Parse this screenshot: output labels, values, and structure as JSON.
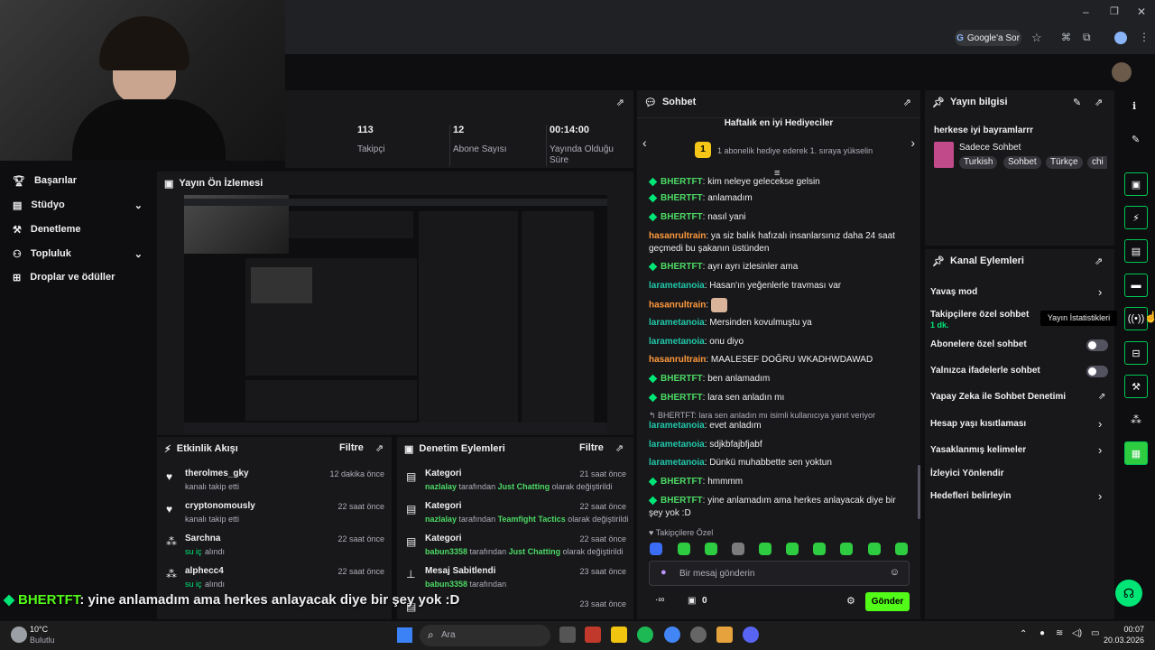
{
  "browser": {
    "google_sor": "Google'a Sor"
  },
  "stats": [
    {
      "value": "113",
      "label": "Takipçi"
    },
    {
      "value": "12",
      "label": "Abone Sayısı"
    },
    {
      "value": "00:14:00",
      "label": "Yayında Olduğu Süre"
    }
  ],
  "sidebar": {
    "items": [
      {
        "label": "Başarılar"
      },
      {
        "label": "Stüdyo"
      },
      {
        "label": "Denetleme"
      },
      {
        "label": "Topluluk"
      },
      {
        "label": "Droplar ve ödüller"
      }
    ]
  },
  "preview": {
    "title": "Yayın Ön İzlemesi"
  },
  "activity": {
    "title": "Etkinlik Akışı",
    "filter": "Filtre",
    "items": [
      {
        "name": "therolmes_gky",
        "sub": "kanalı takip etti",
        "time": "12 dakika önce"
      },
      {
        "name": "cryptonomously",
        "sub": "kanalı takip etti",
        "time": "22 saat önce"
      },
      {
        "name": "Sarchna",
        "sub_accent": "su iç",
        "sub": "alındı",
        "time": "22 saat önce"
      },
      {
        "name": "alphecc4",
        "sub_accent": "su iç",
        "sub": "alındı",
        "time": "22 saat önce"
      }
    ]
  },
  "modlog": {
    "title": "Denetim Eylemleri",
    "filter": "Filtre",
    "items": [
      {
        "title": "Kategori",
        "user": "nazlalay",
        "mid": "tarafından",
        "accent": "Just Chatting",
        "tail": "olarak değiştirildi",
        "time": "21 saat önce"
      },
      {
        "title": "Kategori",
        "user": "nazlalay",
        "mid": "tarafından",
        "accent": "Teamfight Tactics",
        "tail": "olarak değiştirildi",
        "time": "22 saat önce"
      },
      {
        "title": "Kategori",
        "user": "babun3358",
        "mid": "tarafından",
        "accent": "Just Chatting",
        "tail": "olarak değiştirildi",
        "time": "22 saat önce"
      },
      {
        "title": "Mesaj Sabitlendi",
        "user": "babun3358",
        "mid": "tarafından",
        "accent": "",
        "tail": "",
        "time": "23 saat önce"
      },
      {
        "title": "",
        "user": "",
        "mid": "",
        "accent": "",
        "tail": "",
        "time": "23 saat önce"
      }
    ]
  },
  "chat": {
    "title": "Sohbet",
    "gift_title": "Haftalık en iyi Hediyeciler",
    "gift_rank": "1",
    "gift_text": "1 abonelik hediye ederek 1. sıraya yükselin",
    "messages": [
      {
        "user": "BHERTFT",
        "text": "kim neleye gelecekse gelsin"
      },
      {
        "user": "BHERTFT",
        "text": "anlamadım"
      },
      {
        "user": "BHERTFT",
        "text": "nasıl yani"
      },
      {
        "user": "hasanrultrain",
        "text": "ya siz balık hafızalı insanlarsınız daha 24 saat geçmedi bu şakanın üstünden"
      },
      {
        "user": "BHERTFT",
        "text": "ayrı ayrı izlesinler ama"
      },
      {
        "user": "larametanoia",
        "text": "Hasan'ın yeğenlerle travması var"
      },
      {
        "user": "hasanrultrain",
        "text": ""
      },
      {
        "user": "larametanoia",
        "text": "Mersinden kovulmuştu ya"
      },
      {
        "user": "larametanoia",
        "text": "onu diyo"
      },
      {
        "user": "hasanrultrain",
        "text": "MAALESEF DOĞRU WKADHWDAWAD"
      },
      {
        "user": "BHERTFT",
        "text": "ben anlamadım"
      },
      {
        "user": "BHERTFT",
        "text": "lara sen anladın mı"
      },
      {
        "reply": "BHERTFT: lara sen anladın mı isimli kullanıcıya yanıt veriyor"
      },
      {
        "user": "larametanoia",
        "text": "evet anladım"
      },
      {
        "user": "larametanoia",
        "text": "sdjkbfajbfjabf"
      },
      {
        "user": "larametanoia",
        "text": "Dünkü muhabbette sen yoktun"
      },
      {
        "user": "BHERTFT",
        "text": "hmmmm"
      },
      {
        "user": "BHERTFT",
        "text": "yine anlamadım ama herkes anlayacak diye bir şey yok :D"
      }
    ],
    "followers_only": "Takipçilere Özel",
    "input_placeholder": "Bir mesaj gönderin",
    "points": "0",
    "send": "Gönder"
  },
  "stream_info": {
    "title": "Yayın bilgisi",
    "stream_title": "herkese iyi bayramlarrr",
    "category": "Sadece Sohbet",
    "tags": [
      "Turkish",
      "Sohbet",
      "Türkçe",
      "chi"
    ]
  },
  "channel_actions": {
    "title": "Kanal Eylemleri",
    "items": [
      {
        "label": "Yavaş mod"
      },
      {
        "label": "Takipçilere özel sohbet",
        "sub": "1 dk."
      },
      {
        "label": "Abonelere özel sohbet"
      },
      {
        "label": "Yalnızca ifadelerle sohbet"
      },
      {
        "label": "Yapay Zeka ile Sohbet Denetimi"
      },
      {
        "label": "Hesap yaşı kısıtlaması"
      },
      {
        "label": "Yasaklanmış kelimeler"
      },
      {
        "label": "İzleyici Yönlendir"
      },
      {
        "label": "Hedefleri belirleyin"
      }
    ]
  },
  "tooltip": "Yayın İstatistikleri",
  "overlay_chat": {
    "user": "BHERTFT",
    "text": ": yine anlamadım ama herkes anlayacak diye bir şey yok :D"
  },
  "taskbar": {
    "weather_temp": "10°C",
    "weather_text": "Bulutlu",
    "search": "Ara",
    "time": "00:07",
    "date": "20.03.2026"
  }
}
